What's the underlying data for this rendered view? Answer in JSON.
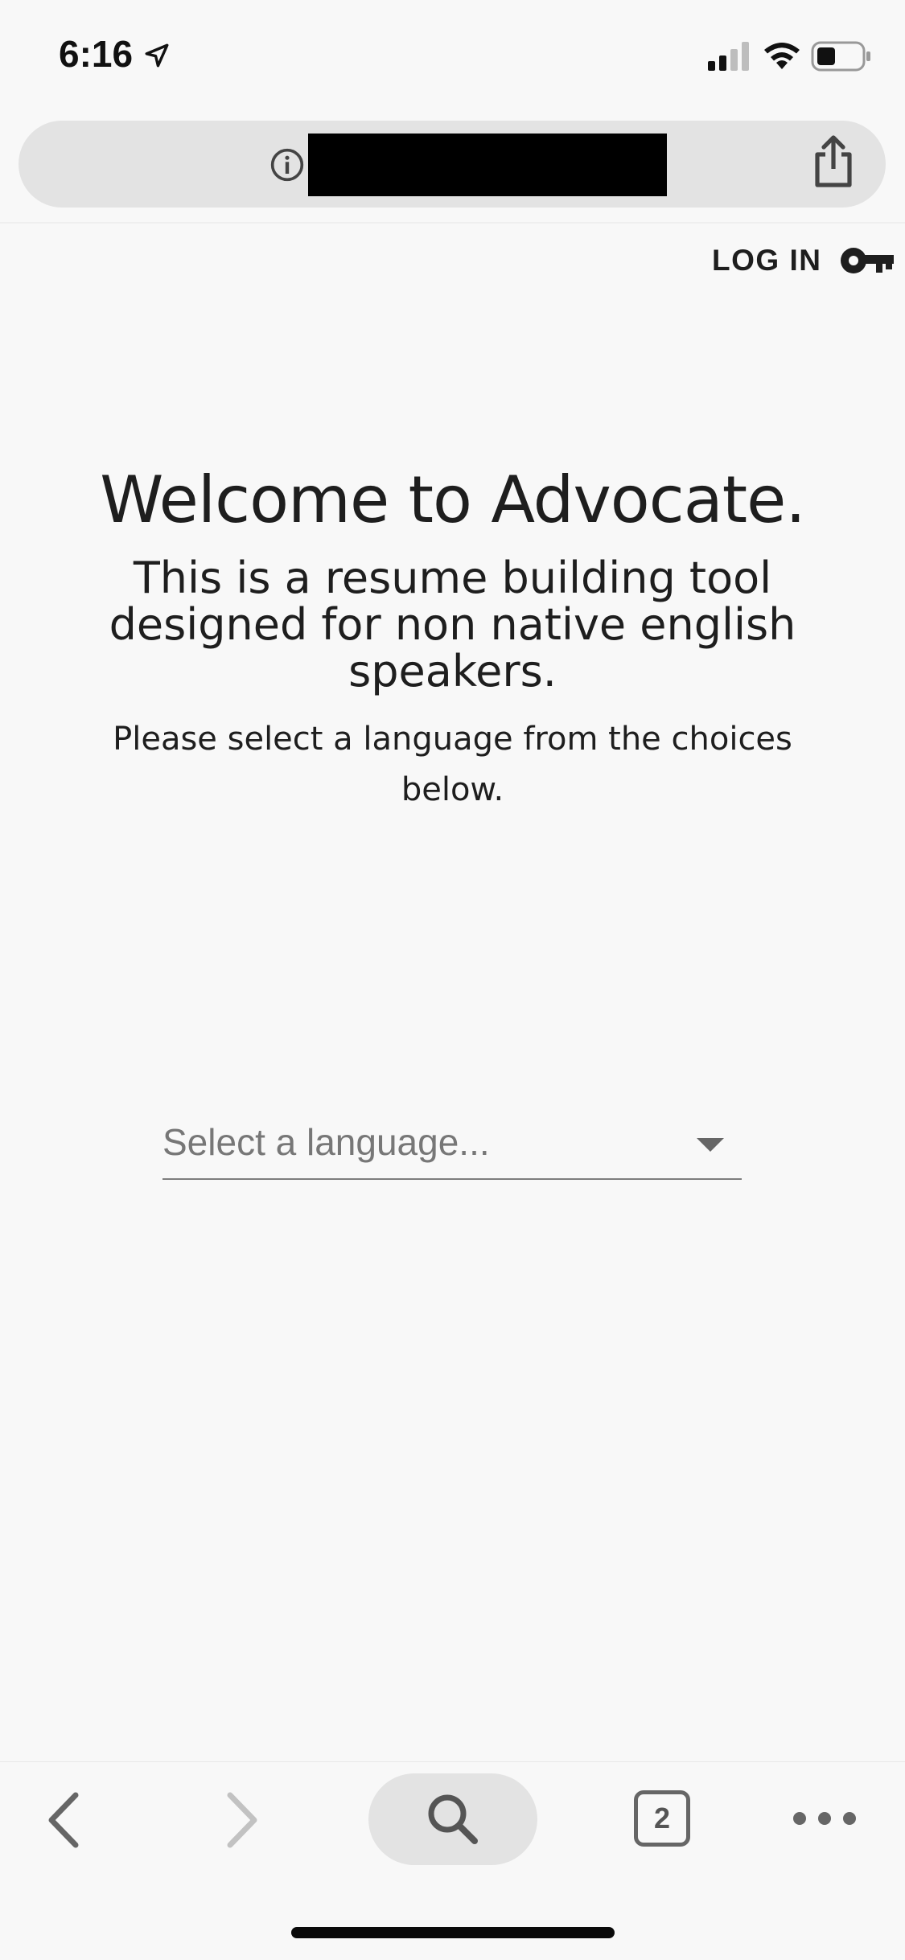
{
  "status_bar": {
    "time": "6:16"
  },
  "browser": {
    "url_redacted": "",
    "tab_count": "2"
  },
  "header": {
    "login_label": "LOG IN"
  },
  "main": {
    "title": "Welcome to Advocate.",
    "subtitle": "This is a resume building tool designed for non native english speakers.",
    "instructions": "Please select a language from the choices below."
  },
  "language_select": {
    "placeholder": "Select a language..."
  },
  "icons": {
    "location": "location-arrow-icon",
    "signal": "cellular-signal-icon",
    "wifi": "wifi-icon",
    "battery": "battery-icon",
    "info": "info-icon",
    "share": "share-icon",
    "key": "key-icon",
    "dropdown": "chevron-down-icon",
    "back": "back-chevron-icon",
    "forward": "forward-chevron-icon",
    "search": "search-icon",
    "more": "more-icon"
  },
  "colors": {
    "background": "#f8f8f8",
    "text": "#1e1e1e",
    "url_bar": "#e3e3e3",
    "placeholder": "#777777"
  }
}
